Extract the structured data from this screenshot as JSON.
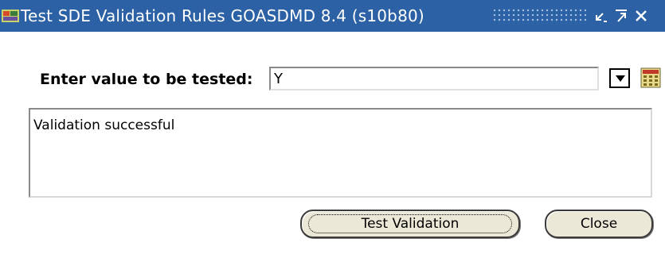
{
  "window": {
    "title": "Test SDE Validation Rules  GOASDMD  8.4  (s10b80)",
    "titlebar_color": "#2c62a5",
    "icons": [
      "app-icon",
      "minimize-icon",
      "maximize-icon",
      "close-icon"
    ]
  },
  "form": {
    "label": "Enter value to be tested:",
    "value": "Y",
    "controls": [
      "dropdown-arrow-icon",
      "calendar-icon"
    ]
  },
  "message": {
    "text": "Validation successful"
  },
  "buttons": {
    "test_validation": "Test Validation",
    "close": "Close",
    "button_color": "#ece8d8"
  }
}
